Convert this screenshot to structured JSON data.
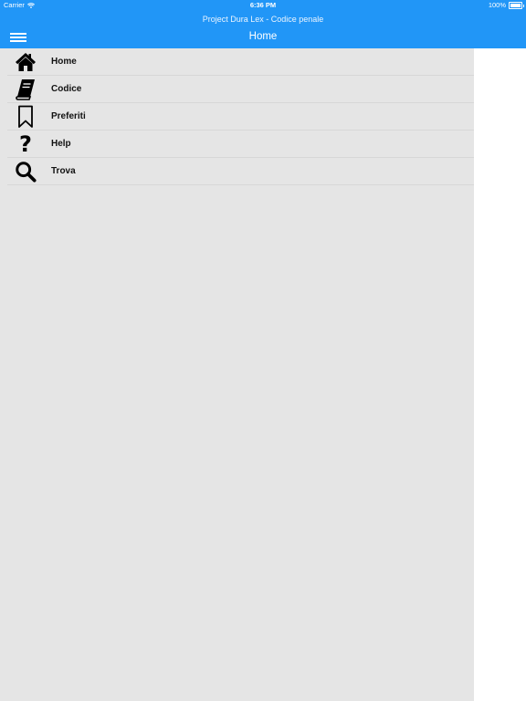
{
  "status_bar": {
    "carrier": "Carrier",
    "time": "6:36 PM",
    "battery": "100%"
  },
  "header": {
    "app_title": "Project Dura Lex - Codice penale",
    "page_title": "Home"
  },
  "menu": {
    "items": [
      {
        "label": "Home",
        "icon": "home-icon"
      },
      {
        "label": "Codice",
        "icon": "book-icon"
      },
      {
        "label": "Preferiti",
        "icon": "bookmark-icon"
      },
      {
        "label": "Help",
        "icon": "question-icon"
      },
      {
        "label": "Trova",
        "icon": "search-icon"
      }
    ]
  },
  "colors": {
    "header": "#2196f7",
    "drawer": "#e5e5e5",
    "divider": "#d7d7d7"
  }
}
